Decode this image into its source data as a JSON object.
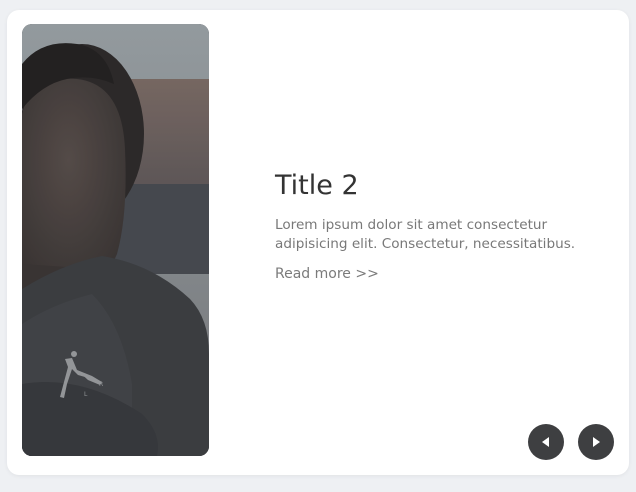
{
  "slide": {
    "image": {
      "subject": "young man wearing dark hoodie with jumpman logo",
      "icon": "jumpman-logo-icon"
    },
    "title": "Title 2",
    "description": "Lorem ipsum dolor sit amet consectetur adipisicing elit. Consectetur, necessitatibus.",
    "read_more": "Read more >>"
  },
  "navigation": {
    "prev_icon": "triangle-left-icon",
    "next_icon": "triangle-right-icon"
  },
  "colors": {
    "background": "#eef0f3",
    "card": "#ffffff",
    "title": "#333333",
    "text": "#787878",
    "nav_button": "#3e3f41"
  }
}
